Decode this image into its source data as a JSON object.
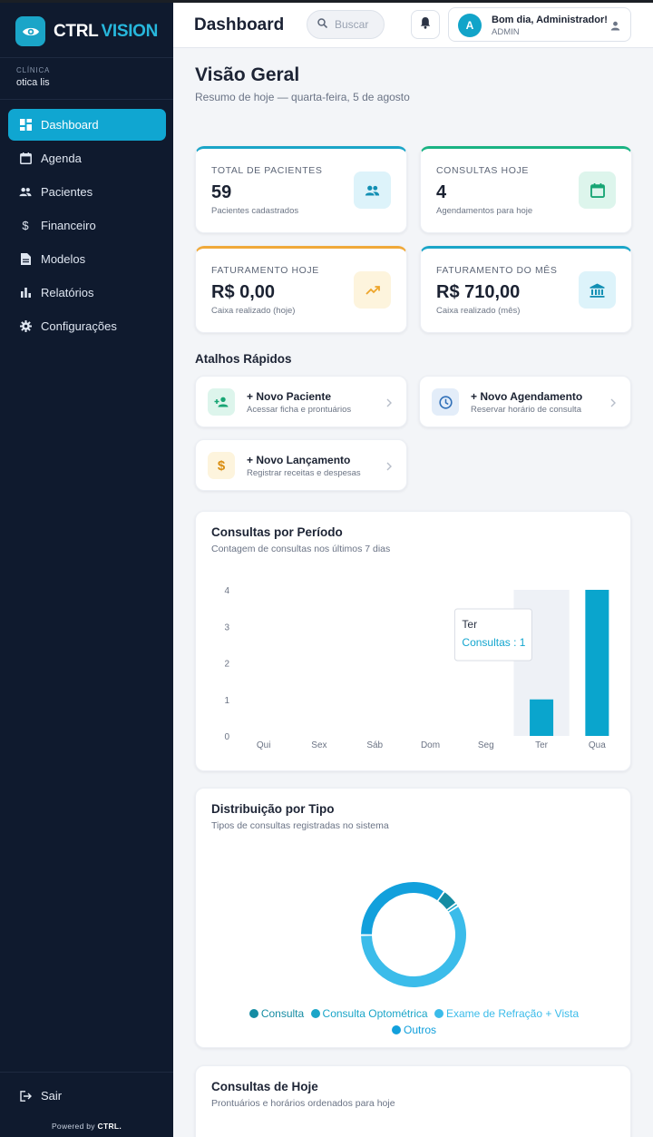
{
  "brand": {
    "name_a": "CTRL",
    "name_b": "VISION",
    "accent": "#10a6d1",
    "sidebar_bg": "#0f1a2e"
  },
  "clinic": {
    "label": "CLÍNICA",
    "name": "otica lis"
  },
  "nav": [
    {
      "label": "Dashboard",
      "icon": "dashboard-icon",
      "active": true
    },
    {
      "label": "Agenda",
      "icon": "calendar-icon"
    },
    {
      "label": "Pacientes",
      "icon": "people-icon"
    },
    {
      "label": "Financeiro",
      "icon": "dollar-icon"
    },
    {
      "label": "Modelos",
      "icon": "document-icon"
    },
    {
      "label": "Relatórios",
      "icon": "bar-chart-icon"
    },
    {
      "label": "Configurações",
      "icon": "gear-icon"
    }
  ],
  "logout": {
    "label": "Sair"
  },
  "powered": {
    "prefix": "Powered by",
    "name": "CTRL."
  },
  "header": {
    "title": "Dashboard",
    "search_placeholder": "Buscar",
    "greeting": "Bom dia, Administrador!",
    "role": "ADMIN",
    "avatar_letter": "A"
  },
  "overview": {
    "title": "Visão Geral",
    "subtitle": "Resumo de hoje — quarta-feira, 5 de agosto"
  },
  "stats": [
    {
      "label": "TOTAL DE PACIENTES",
      "value": "59",
      "note": "Pacientes cadastrados",
      "icon": "people-icon",
      "color": "#1aa5c8"
    },
    {
      "label": "CONSULTAS HOJE",
      "value": "4",
      "note": "Agendamentos para hoje",
      "icon": "calendar-icon",
      "color": "#19b383"
    },
    {
      "label": "FATURAMENTO HOJE",
      "value": "R$ 0,00",
      "note": "Caixa realizado (hoje)",
      "icon": "trending-up-icon",
      "color": "#f0a93a"
    },
    {
      "label": "FATURAMENTO DO MÊS",
      "value": "R$ 710,00",
      "note": "Caixa realizado (mês)",
      "icon": "bank-icon",
      "color": "#1aa5c8"
    }
  ],
  "shortcuts": {
    "title": "Atalhos Rápidos",
    "items": [
      {
        "title": "+ Novo Paciente",
        "sub": "Acessar ficha e prontuários",
        "icon": "add-person-icon"
      },
      {
        "title": "+ Novo Agendamento",
        "sub": "Reservar horário de consulta",
        "icon": "clock-icon"
      },
      {
        "title": "+ Novo Lançamento",
        "sub": "Registrar receitas e despesas",
        "icon": "dollar-icon"
      }
    ]
  },
  "period_chart": {
    "title": "Consultas por Período",
    "subtitle": "Contagem de consultas nos últimos 7 dias",
    "tooltip": {
      "label": "Ter",
      "value_text": "Consultas : 1"
    }
  },
  "chart_data": [
    {
      "type": "bar",
      "categories": [
        "Qui",
        "Sex",
        "Sáb",
        "Dom",
        "Seg",
        "Ter",
        "Qua"
      ],
      "series": [
        {
          "name": "Consultas",
          "values": [
            0,
            0,
            0,
            0,
            0,
            1,
            4
          ]
        }
      ],
      "ylim": [
        0,
        4
      ],
      "yticks": [
        "0",
        "1",
        "2",
        "3",
        "4"
      ],
      "highlighted_category": "Ter",
      "color": "#0aa5cd"
    },
    {
      "type": "pie",
      "series": [
        {
          "values": [
            5,
            1,
            59,
            35
          ]
        }
      ],
      "labels": [
        "Consulta",
        "Consulta Optométrica",
        "Exame de Refração + Vista",
        "Outros"
      ],
      "colors": [
        "#158ca3",
        "#1aa5c8",
        "#3bbcea",
        "#12a0dc"
      ]
    }
  ],
  "type_chart": {
    "title": "Distribuição por Tipo",
    "subtitle": "Tipos de consultas registradas no sistema",
    "legend": [
      "Consulta",
      "Consulta Optométrica",
      "Exame de Refração + Vista",
      "Outros"
    ]
  },
  "today": {
    "title": "Consultas de Hoje",
    "subtitle": "Prontuários e horários ordenados para hoje"
  }
}
